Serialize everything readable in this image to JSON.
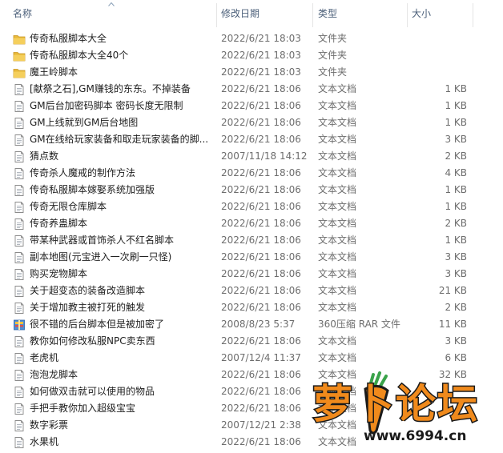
{
  "columns": {
    "name": "名称",
    "date": "修改日期",
    "type": "类型",
    "size": "大小"
  },
  "files": [
    {
      "icon": "folder-icon",
      "name": "传奇私服脚本大全",
      "date": "2022/6/21 18:03",
      "type": "文件夹",
      "size": ""
    },
    {
      "icon": "folder-icon",
      "name": "传奇私服脚本大全40个",
      "date": "2022/6/21 18:03",
      "type": "文件夹",
      "size": ""
    },
    {
      "icon": "folder-icon",
      "name": "魔王岭脚本",
      "date": "2022/6/21 18:03",
      "type": "文件夹",
      "size": ""
    },
    {
      "icon": "text-file-icon",
      "name": "[献祭之石],GM赚钱的东东。不掉装备",
      "date": "2022/6/21 18:06",
      "type": "文本文档",
      "size": "1 KB"
    },
    {
      "icon": "text-file-icon",
      "name": "GM后台加密码脚本 密码长度无限制",
      "date": "2022/6/21 18:06",
      "type": "文本文档",
      "size": "1 KB"
    },
    {
      "icon": "text-file-icon",
      "name": "GM上线就到GM后台地图",
      "date": "2022/6/21 18:06",
      "type": "文本文档",
      "size": "1 KB"
    },
    {
      "icon": "text-file-icon",
      "name": "GM在线给玩家装备和取走玩家装备的脚...",
      "date": "2022/6/21 18:06",
      "type": "文本文档",
      "size": "3 KB"
    },
    {
      "icon": "text-file-icon",
      "name": "猜点数",
      "date": "2007/11/18 14:12",
      "type": "文本文档",
      "size": "2 KB"
    },
    {
      "icon": "text-file-icon",
      "name": "传奇杀人魔戒的制作方法",
      "date": "2022/6/21 18:06",
      "type": "文本文档",
      "size": "4 KB"
    },
    {
      "icon": "text-file-icon",
      "name": "传奇私服脚本嫁娶系统加强版",
      "date": "2022/6/21 18:06",
      "type": "文本文档",
      "size": "1 KB"
    },
    {
      "icon": "text-file-icon",
      "name": "传奇无限仓库脚本",
      "date": "2022/6/21 18:06",
      "type": "文本文档",
      "size": "1 KB"
    },
    {
      "icon": "text-file-icon",
      "name": "传奇养蛊脚本",
      "date": "2022/6/21 18:06",
      "type": "文本文档",
      "size": "2 KB"
    },
    {
      "icon": "text-file-icon",
      "name": "带某种武器或首饰杀人不红名脚本",
      "date": "2022/6/21 18:06",
      "type": "文本文档",
      "size": "1 KB"
    },
    {
      "icon": "text-file-icon",
      "name": "副本地图(元宝进入一次刷一只怪)",
      "date": "2022/6/21 18:06",
      "type": "文本文档",
      "size": "3 KB"
    },
    {
      "icon": "text-file-icon",
      "name": "购买宠物脚本",
      "date": "2022/6/21 18:06",
      "type": "文本文档",
      "size": "3 KB"
    },
    {
      "icon": "text-file-icon",
      "name": "关于超变态的装备改造脚本",
      "date": "2022/6/21 18:06",
      "type": "文本文档",
      "size": "21 KB"
    },
    {
      "icon": "text-file-icon",
      "name": "关于增加教主被打死的触发",
      "date": "2022/6/21 18:06",
      "type": "文本文档",
      "size": "2 KB"
    },
    {
      "icon": "rar-archive-icon",
      "name": "很不错的后台脚本但是被加密了",
      "date": "2008/8/23 5:37",
      "type": "360压缩 RAR 文件",
      "size": "11 KB"
    },
    {
      "icon": "text-file-icon",
      "name": "教你如何修改私服NPC卖东西",
      "date": "2022/6/21 18:06",
      "type": "文本文档",
      "size": "3 KB"
    },
    {
      "icon": "text-file-icon",
      "name": "老虎机",
      "date": "2007/12/4 11:37",
      "type": "文本文档",
      "size": "6 KB"
    },
    {
      "icon": "text-file-icon",
      "name": "泡泡龙脚本",
      "date": "2022/6/21 18:06",
      "type": "文本文档",
      "size": "32 KB"
    },
    {
      "icon": "text-file-icon",
      "name": "如何做双击就可以使用的物品",
      "date": "2022/6/21 18:06",
      "type": "文本文档",
      "size": ""
    },
    {
      "icon": "text-file-icon",
      "name": "手把手教你加入超级宝宝",
      "date": "2022/6/21 18:06",
      "type": "文本文档",
      "size": ""
    },
    {
      "icon": "text-file-icon",
      "name": "数字彩票",
      "date": "2007/12/21 2:38",
      "type": "文本文档",
      "size": ""
    },
    {
      "icon": "text-file-icon",
      "name": "水果机",
      "date": "2022/6/21 18:06",
      "type": "文本文档",
      "size": ""
    }
  ],
  "watermark": {
    "logo_text": "萝卜论坛",
    "url": "www.6994.cn"
  },
  "colors": {
    "folder": "#e8b93a",
    "header_text": "#4c607a",
    "secondary_text": "#6d6d6d",
    "watermark_orange": "#f08a1c"
  }
}
